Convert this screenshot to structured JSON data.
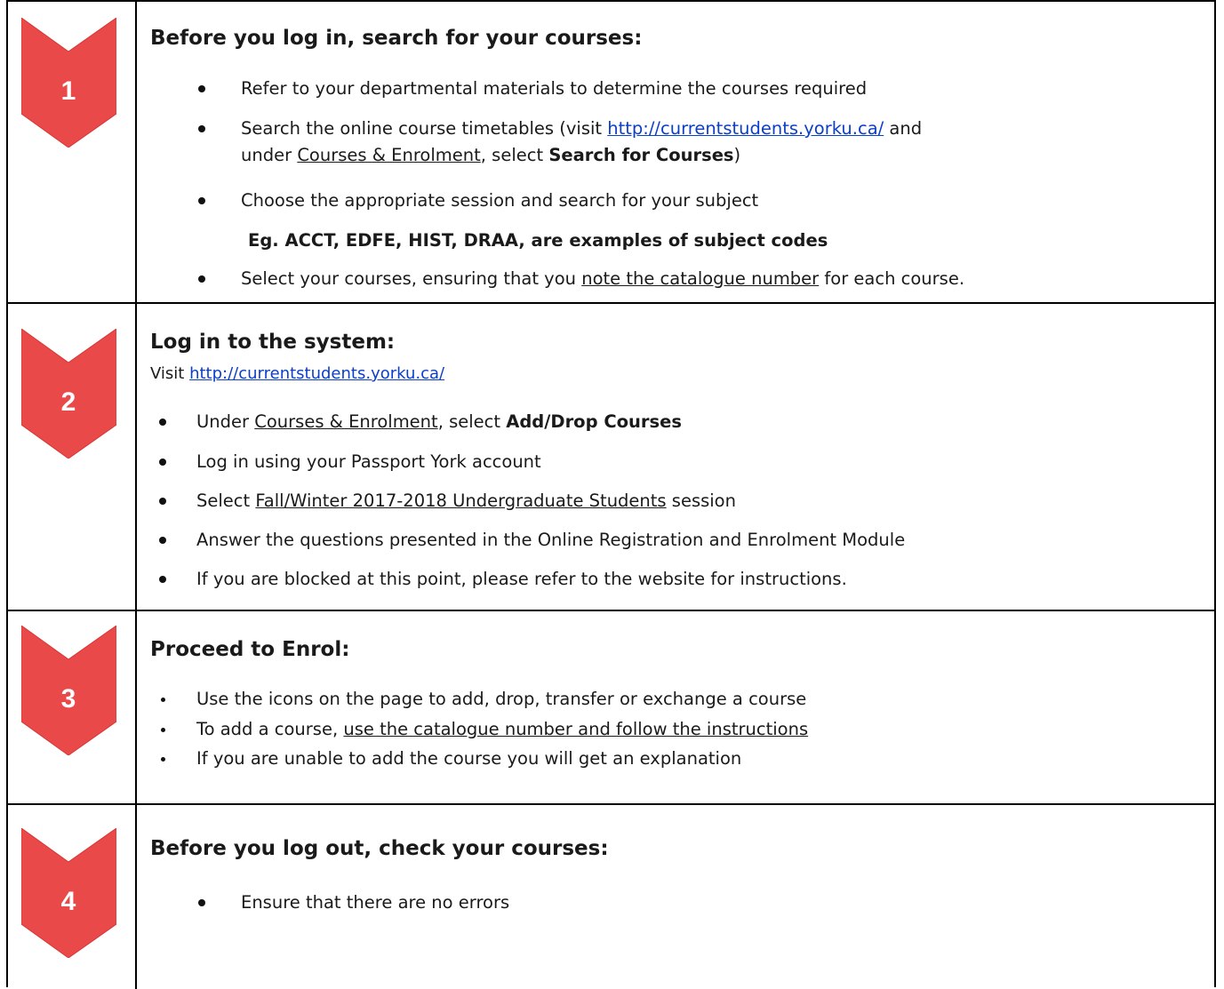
{
  "colors": {
    "chevron": "#ea4949",
    "chevron_edge": "#d93535",
    "link": "#0b3fc9",
    "border": "#000000"
  },
  "steps": [
    {
      "number": "1",
      "heading": "Before you log in, search for your courses:",
      "b1": "Refer to your departmental materials to determine the courses required",
      "b2_pre": "Search the online course timetables (visit ",
      "b2_link": "http://currentstudents.yorku.ca/",
      "b2_post": " and",
      "b2_line2_link": "Courses & Enrolment",
      "b2_line2_pre": "under ",
      "b2_line2_mid": ", select ",
      "b2_line2_bold": "Search for Courses",
      "b2_line2_end": ")",
      "b3": "Choose the appropriate session  and search for your subject",
      "b3_example": "Eg.  ACCT, EDFE, HIST, DRAA, are examples of subject codes",
      "b4_pre": "Select your courses, ensuring that you ",
      "b4_u": "note the catalogue  number",
      "b4_post": " for each course."
    },
    {
      "number": "2",
      "heading": "Log in to the system:",
      "visit_pre": "Visit ",
      "visit_link": "http://currentstudents.yorku.ca/",
      "b1_pre": "Under ",
      "b1_u": "Courses & Enrolment",
      "b1_mid": ", select ",
      "b1_bold": "Add/Drop Courses",
      "b2": "Log in using your Passport York account",
      "b3_pre": "Select ",
      "b3_u": "Fall/Winter 2017-2018 Undergraduate Students",
      "b3_post": " session",
      "b4": "Answer the questions presented in the Online Registration and Enrolment Module",
      "b5": "If you are blocked at this point, please refer to the website for instructions."
    },
    {
      "number": "3",
      "heading": "Proceed to Enrol:",
      "b1": "Use the icons on the page to add, drop, transfer or exchange a course",
      "b2_pre": "To add a course, ",
      "b2_u": "use the catalogue number and follow the instructions",
      "b3": "If you are unable to add the course you will get an explanation"
    },
    {
      "number": "4",
      "heading": "Before you log out, check your courses:",
      "b1": "Ensure that there are no errors"
    }
  ]
}
